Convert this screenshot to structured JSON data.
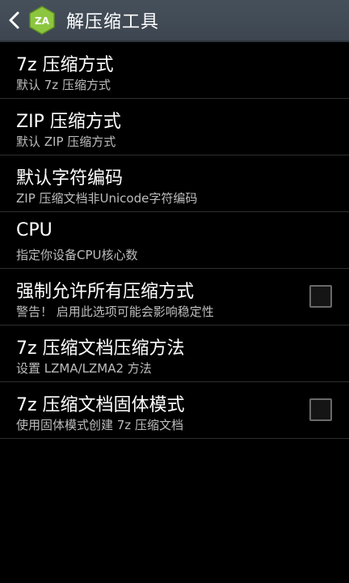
{
  "app": {
    "title": "解压缩工具",
    "icon_letter": "ZA",
    "icon_color": "#8cc63f"
  },
  "preferences": [
    {
      "title": "7z 压缩方式",
      "summary": "默认 7z 压缩方式",
      "has_checkbox": false
    },
    {
      "title": "ZIP 压缩方式",
      "summary": "默认 ZIP 压缩方式",
      "has_checkbox": false
    },
    {
      "title": "默认字符编码",
      "summary": "ZIP 压缩文档非Unicode字符编码",
      "has_checkbox": false
    },
    {
      "title": "CPU",
      "summary": "指定你设备CPU核心数",
      "has_checkbox": false
    },
    {
      "title": "强制允许所有压缩方式",
      "summary": "警告！ 启用此选项可能会影响稳定性",
      "has_checkbox": true,
      "checked": false
    },
    {
      "title": "7z 压缩文档压缩方法",
      "summary": "设置 LZMA/LZMA2 方法",
      "has_checkbox": false
    },
    {
      "title": "7z 压缩文档固体模式",
      "summary": "使用固体模式创建 7z 压缩文档",
      "has_checkbox": true,
      "checked": false
    }
  ]
}
